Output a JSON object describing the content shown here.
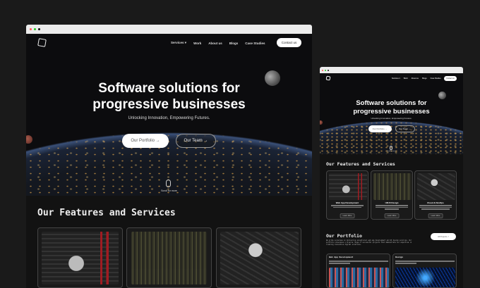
{
  "nav": {
    "items": [
      "Services",
      "Work",
      "About us",
      "Blogs",
      "Case Studies"
    ],
    "contact": "Contact us"
  },
  "hero": {
    "title_line1": "Software solutions for",
    "title_line2": "progressive businesses",
    "subtitle": "Unlocking Innovation, Empowering Futures.",
    "portfolio_btn": "Our Portfolio",
    "team_btn": "Our Team",
    "scroll": "Scroll for more"
  },
  "features": {
    "heading": "Our Features and Services",
    "cards": [
      {
        "title": "Web App Development"
      },
      {
        "title": "UI/UX Design"
      },
      {
        "title": "Cloud & DevOps"
      }
    ],
    "learn_more": "Learn More"
  },
  "portfolio": {
    "heading": "Our Portfolio",
    "description": "We pride ourselves on delivering exceptional web app development and UI design services. Our portfolio showcases a diverse range of successful projects that demonstrate our expertise in creating innovative digital solutions.",
    "all_projects": "All Projects ↗",
    "cards": [
      {
        "title": "Web App Development"
      },
      {
        "title": "Design"
      }
    ]
  },
  "colors": {
    "bg": "#1a1a1a",
    "page": "#121212",
    "accent_red": "#a01c22"
  }
}
